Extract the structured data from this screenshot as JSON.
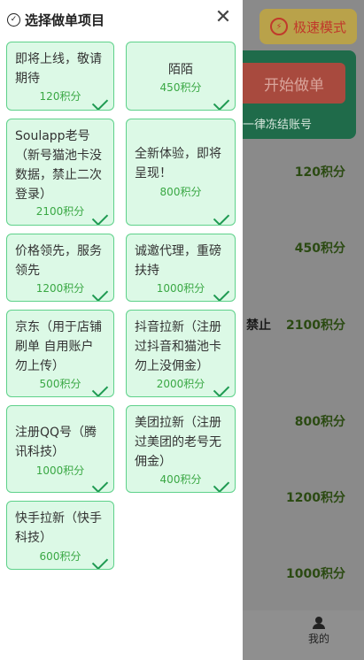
{
  "background": {
    "speed_mode": "极速模式",
    "start_button": "开始做单",
    "freeze_notice": "一律冻结账号",
    "forbid_label": "禁止",
    "list_points": [
      "120积分",
      "450积分",
      "2100积分",
      "800积分",
      "1200积分",
      "1000积分"
    ],
    "tab_me": "我的"
  },
  "drawer": {
    "title": "选择做单项目",
    "close_symbol": "✕"
  },
  "projects": [
    {
      "name": "即将上线，敬请期待",
      "points": "120积分"
    },
    {
      "name": "陌陌",
      "points": "450积分"
    },
    {
      "name": "Soulapp老号（新号猫池卡没数据，禁止二次登录）",
      "points": "2100积分"
    },
    {
      "name": "全新体验，即将呈现！",
      "points": "800积分"
    },
    {
      "name": "价格领先，服务领先",
      "points": "1200积分"
    },
    {
      "name": "诚邀代理，重磅扶持",
      "points": "1000积分"
    },
    {
      "name": "京东（用于店铺刷单 自用账户勿上传）",
      "points": "500积分"
    },
    {
      "name": "抖音拉新（注册过抖音和猫池卡勿上没佣金）",
      "points": "2000积分"
    },
    {
      "name": "注册QQ号（腾讯科技）",
      "points": "1000积分"
    },
    {
      "name": "美团拉新（注册过美团的老号无佣金）",
      "points": "400积分"
    },
    {
      "name": "快手拉新（快手科技）",
      "points": "600积分"
    }
  ]
}
